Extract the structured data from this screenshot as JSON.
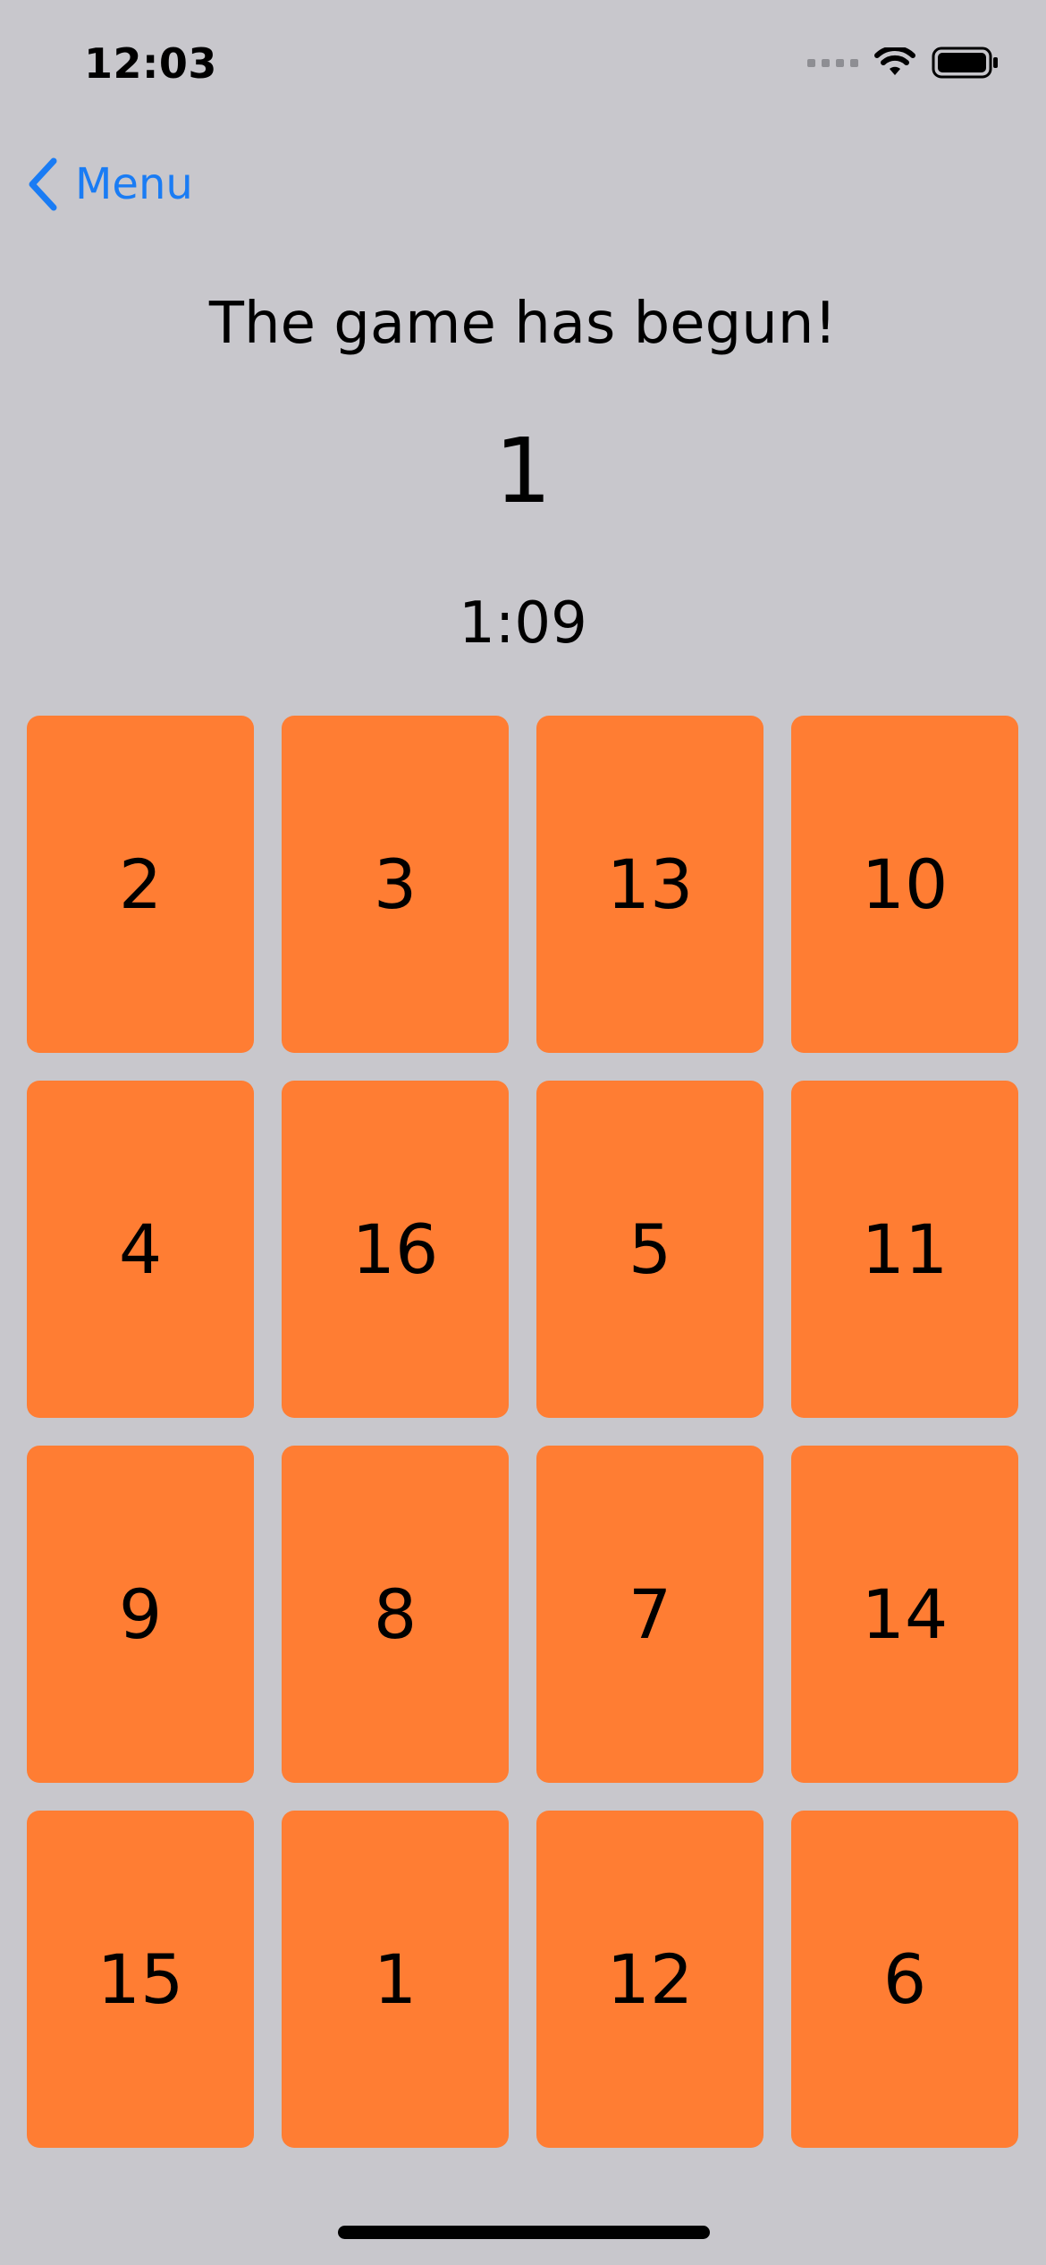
{
  "status_bar": {
    "time": "12:03"
  },
  "nav": {
    "back_label": "Menu",
    "back_icon": "chevron-left-icon",
    "accent_color": "#1a7cf4"
  },
  "game": {
    "headline": "The game has begun!",
    "target_number": "1",
    "timer": "1:09",
    "tile_color": "#ff7d33",
    "tiles": [
      "2",
      "3",
      "13",
      "10",
      "4",
      "16",
      "5",
      "11",
      "9",
      "8",
      "7",
      "14",
      "15",
      "1",
      "12",
      "6"
    ]
  }
}
